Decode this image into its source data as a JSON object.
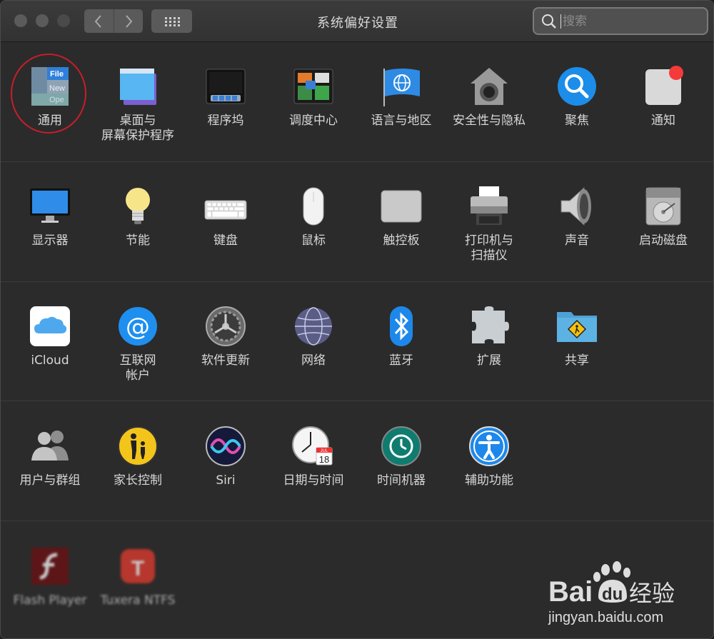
{
  "window": {
    "title": "系统偏好设置"
  },
  "toolbar": {
    "back": "‹",
    "forward": "›",
    "grid": "show-all"
  },
  "search": {
    "placeholder": "搜索",
    "value": ""
  },
  "rows": [
    [
      {
        "label": "通用",
        "icon": "general-icon"
      },
      {
        "label": "桌面与\n屏幕保护程序",
        "icon": "desktop-icon"
      },
      {
        "label": "程序坞",
        "icon": "dock-icon"
      },
      {
        "label": "调度中心",
        "icon": "mission-control-icon"
      },
      {
        "label": "语言与地区",
        "icon": "language-globe-icon"
      },
      {
        "label": "安全性与隐私",
        "icon": "security-house-icon"
      },
      {
        "label": "聚焦",
        "icon": "spotlight-icon"
      },
      {
        "label": "通知",
        "icon": "notifications-icon"
      }
    ],
    [
      {
        "label": "显示器",
        "icon": "display-icon"
      },
      {
        "label": "节能",
        "icon": "energy-bulb-icon"
      },
      {
        "label": "键盘",
        "icon": "keyboard-icon"
      },
      {
        "label": "鼠标",
        "icon": "mouse-icon"
      },
      {
        "label": "触控板",
        "icon": "trackpad-icon"
      },
      {
        "label": "打印机与\n扫描仪",
        "icon": "printer-icon"
      },
      {
        "label": "声音",
        "icon": "speaker-icon"
      },
      {
        "label": "启动磁盘",
        "icon": "disk-icon"
      }
    ],
    [
      {
        "label": "iCloud",
        "icon": "icloud-icon"
      },
      {
        "label": "互联网\n帐户",
        "icon": "internet-accounts-icon"
      },
      {
        "label": "软件更新",
        "icon": "software-update-gear-icon"
      },
      {
        "label": "网络",
        "icon": "network-globe-icon"
      },
      {
        "label": "蓝牙",
        "icon": "bluetooth-icon"
      },
      {
        "label": "扩展",
        "icon": "extensions-puzzle-icon"
      },
      {
        "label": "共享",
        "icon": "sharing-folder-icon"
      }
    ],
    [
      {
        "label": "用户与群组",
        "icon": "users-icon"
      },
      {
        "label": "家长控制",
        "icon": "parental-controls-icon"
      },
      {
        "label": "Siri",
        "icon": "siri-icon"
      },
      {
        "label": "日期与时间",
        "icon": "clock-calendar-icon"
      },
      {
        "label": "时间机器",
        "icon": "time-machine-icon"
      },
      {
        "label": "辅助功能",
        "icon": "accessibility-icon"
      }
    ],
    [
      {
        "label": "Flash Player",
        "icon": "flash-icon"
      },
      {
        "label": "Tuxera NTFS",
        "icon": "tuxera-icon"
      }
    ]
  ],
  "icon_text": {
    "general_lines": [
      "File",
      "New",
      "Ope"
    ],
    "calendar_month": "JUL",
    "calendar_day": "18"
  },
  "watermark": {
    "brand": "Bai",
    "brand2": "du",
    "product": "经验",
    "url": "jingyan.baidu.com"
  },
  "colors": {
    "annotation": "#c81e2a",
    "background": "#2b2b2b"
  }
}
